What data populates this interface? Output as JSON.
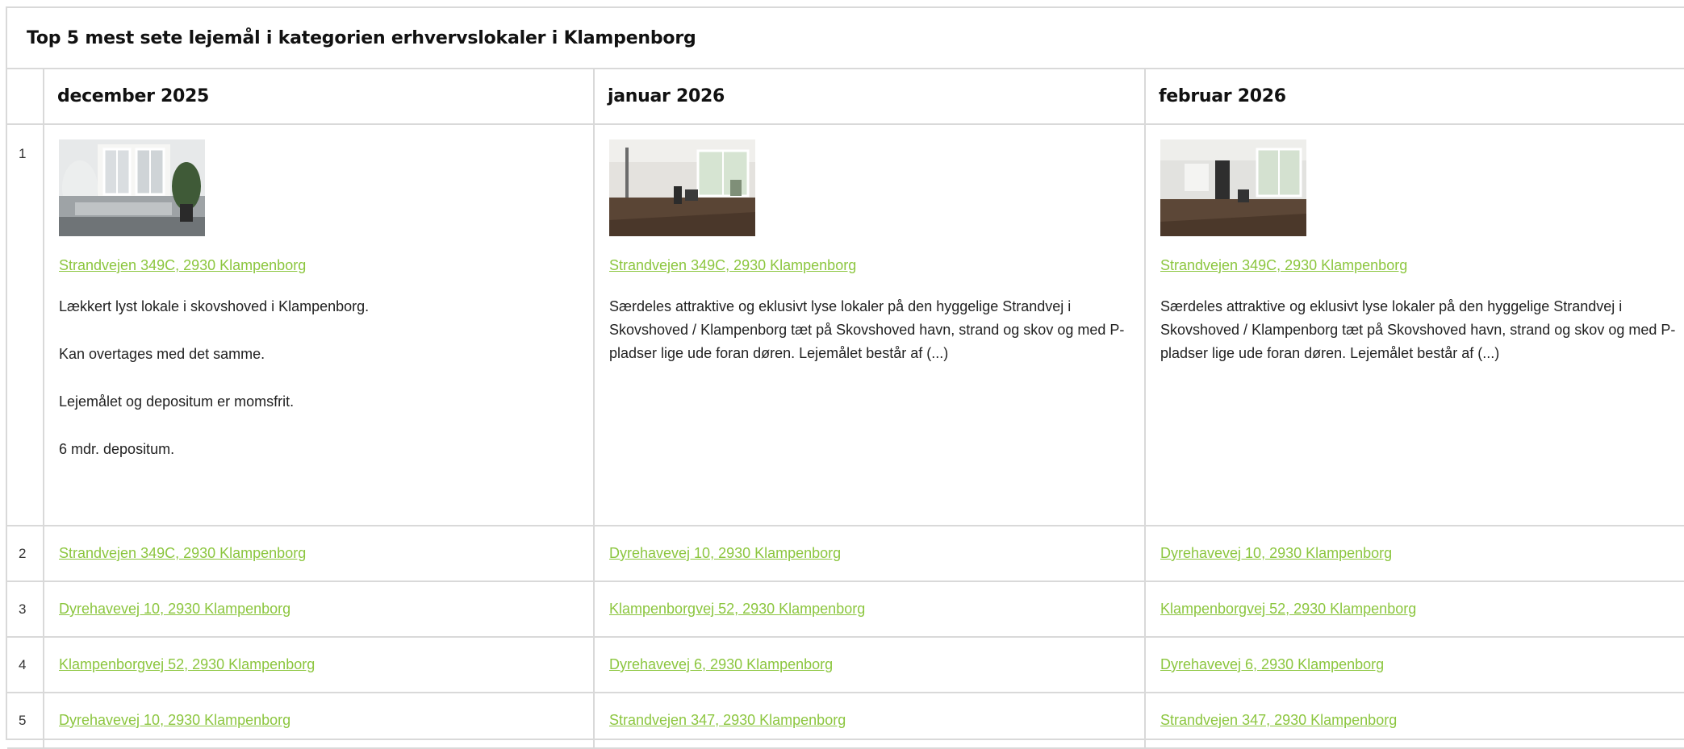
{
  "title": "Top 5 mest sete lejemål i kategorien erhvervslokaler i Klampenborg",
  "columns": [
    "december 2025",
    "januar 2026",
    "februar 2026"
  ],
  "colors": {
    "link": "#8cc63f",
    "border": "#d9d9d9"
  },
  "top": {
    "rank": "1",
    "cells": [
      {
        "image": "shopfront-photo",
        "address": "Strandvejen 349C, 2930 Klampenborg",
        "paragraphs": [
          "Lækkert lyst lokale i skovshoved i Klampenborg.",
          "Kan overtages med det samme.",
          "Lejemålet og depositum er momsfrit.",
          "6 mdr. depositum."
        ]
      },
      {
        "image": "interior-photo",
        "address": "Strandvejen 349C, 2930 Klampenborg",
        "paragraphs": [
          "Særdeles attraktive og eklusivt lyse lokaler på den hyggelige Strandvej i Skovshoved / Klampenborg tæt på Skovshoved havn, strand og skov og med P-pladser lige ude foran døren. Lejemålet består af (...)"
        ]
      },
      {
        "image": "interior-photo",
        "address": "Strandvejen 349C, 2930 Klampenborg",
        "paragraphs": [
          "Særdeles attraktive og eklusivt lyse lokaler på den hyggelige Strandvej i Skovshoved / Klampenborg tæt på Skovshoved havn, strand og skov og med P-pladser lige ude foran døren. Lejemålet består af (...)"
        ]
      }
    ]
  },
  "rows": [
    {
      "rank": "2",
      "cells": [
        "Strandvejen 349C, 2930 Klampenborg",
        "Dyrehavevej 10, 2930 Klampenborg",
        "Dyrehavevej 10, 2930 Klampenborg"
      ]
    },
    {
      "rank": "3",
      "cells": [
        "Dyrehavevej 10, 2930 Klampenborg",
        "Klampenborgvej 52, 2930 Klampenborg",
        "Klampenborgvej 52, 2930 Klampenborg"
      ]
    },
    {
      "rank": "4",
      "cells": [
        "Klampenborgvej 52, 2930 Klampenborg",
        "Dyrehavevej 6, 2930 Klampenborg",
        "Dyrehavevej 6, 2930 Klampenborg"
      ]
    },
    {
      "rank": "5",
      "cells": [
        "Dyrehavevej 10, 2930 Klampenborg",
        "Strandvejen 347, 2930 Klampenborg",
        "Strandvejen 347, 2930 Klampenborg"
      ]
    }
  ]
}
